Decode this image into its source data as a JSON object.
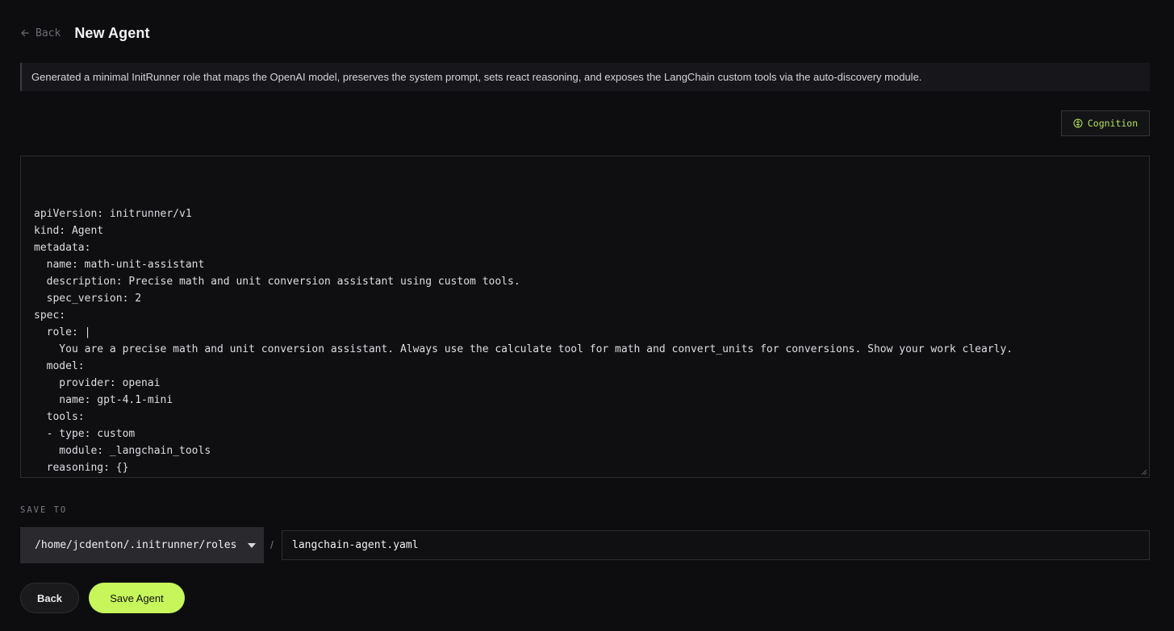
{
  "header": {
    "back_label": "Back",
    "title": "New Agent"
  },
  "summary": {
    "text": "Generated a minimal InitRunner role that maps the OpenAI model, preserves the system prompt, sets react reasoning, and exposes the LangChain custom tools via the auto-discovery module."
  },
  "cognition": {
    "label": "Cognition",
    "icon": "brain-icon",
    "color": "#b4e35a"
  },
  "editor": {
    "lines": [
      "apiVersion: initrunner/v1",
      "kind: Agent",
      "metadata:",
      "  name: math-unit-assistant",
      "  description: Precise math and unit conversion assistant using custom tools.",
      "  spec_version: 2",
      "spec:",
      "  role: |",
      "    You are a precise math and unit conversion assistant. Always use the calculate tool for math and convert_units for conversions. Show your work clearly.",
      "  model:",
      "    provider: openai",
      "    name: gpt-4.1-mini",
      "  tools:",
      "  - type: custom",
      "    module: _langchain_tools",
      "  reasoning: {}"
    ]
  },
  "save": {
    "label": "SAVE TO",
    "directory": "/home/jcdenton/.initrunner/roles",
    "separator": "/",
    "filename": "langchain-agent.yaml"
  },
  "actions": {
    "back_label": "Back",
    "save_label": "Save Agent",
    "accent": "#c6f65a"
  }
}
